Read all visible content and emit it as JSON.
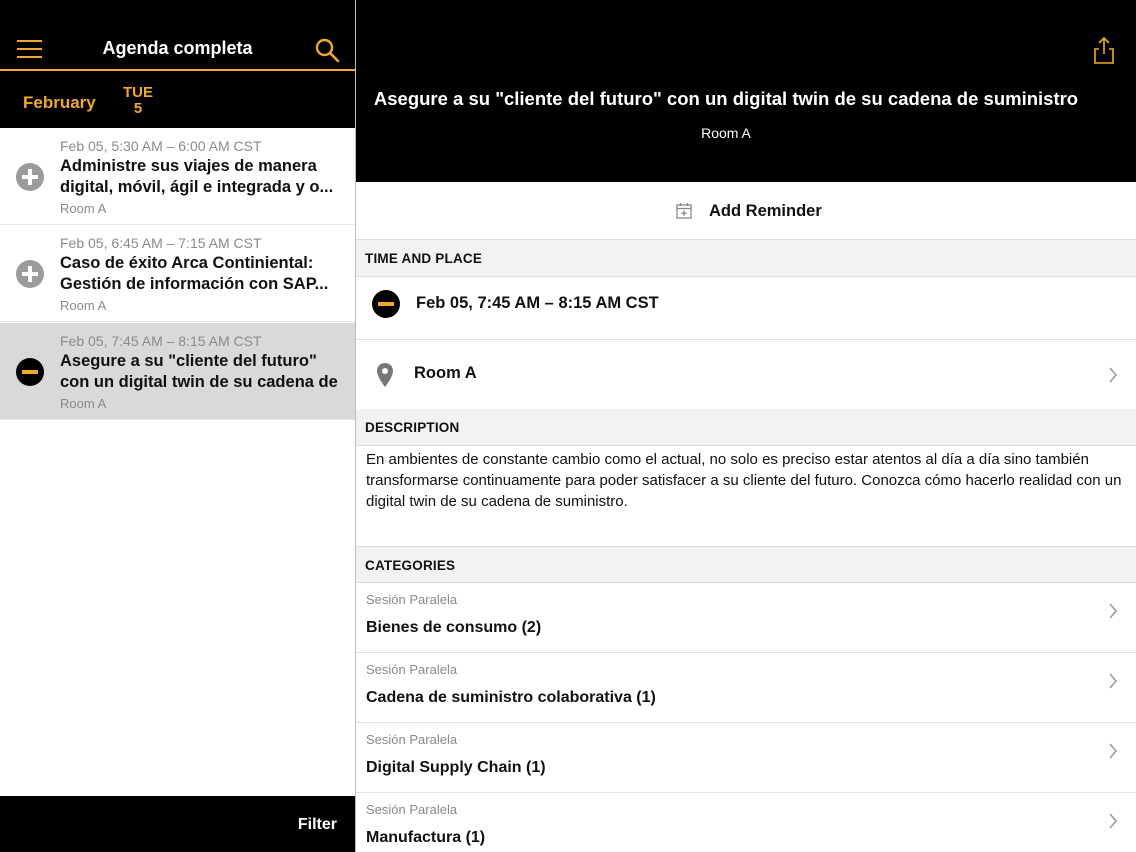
{
  "left": {
    "title": "Agenda completa",
    "month": "February",
    "day_name": "TUE",
    "day_number": "5",
    "sessions": [
      {
        "time": "Feb 05, 5:30 AM – 6:00 AM CST",
        "title": "Administre sus viajes de manera digital, móvil, ágil e integrada y o...",
        "room": "Room A",
        "state": "add"
      },
      {
        "time": "Feb 05, 6:45 AM – 7:15 AM CST",
        "title": "Caso de éxito Arca Continiental: Gestión de información con SAP...",
        "room": "Room A",
        "state": "add"
      },
      {
        "time": "Feb 05, 7:45 AM – 8:15 AM CST",
        "title": "Asegure a su \"cliente del futuro\" con un digital twin de su cadena de su...",
        "room": "Room A",
        "state": "remove"
      }
    ],
    "filter_label": "Filter"
  },
  "detail": {
    "title": "Asegure a su \"cliente del futuro\" con un digital twin de su cadena de suministro",
    "room": "Room A",
    "reminder_label": "Add Reminder",
    "time_place_header": "TIME AND PLACE",
    "time": "Feb 05, 7:45 AM – 8:15 AM CST",
    "location": "Room A",
    "description_header": "DESCRIPTION",
    "description": "En ambientes de constante cambio como el actual, no solo es preciso estar atentos al día a día sino también transformarse continuamente para poder satisfacer a su cliente del futuro. Conozca cómo hacerlo realidad con un digital twin de su cadena de suministro.",
    "categories_header": "CATEGORIES",
    "categories": [
      {
        "type": "Sesión Paralela",
        "name": "Bienes de consumo (2)"
      },
      {
        "type": "Sesión Paralela",
        "name": "Cadena de suministro colaborativa (1)"
      },
      {
        "type": "Sesión Paralela",
        "name": "Digital Supply Chain (1)"
      },
      {
        "type": "Sesión Paralela",
        "name": "Manufactura (1)"
      }
    ]
  },
  "colors": {
    "accent": "#f0a92c",
    "header_bg": "#000000",
    "selected_row": "#d9d9d9",
    "section_bg": "#f2f2f2"
  },
  "icons": [
    "menu-icon",
    "search-icon",
    "share-icon",
    "calendar-add-icon",
    "location-pin-icon",
    "chevron-right-icon",
    "add-circle-icon",
    "remove-circle-icon"
  ]
}
